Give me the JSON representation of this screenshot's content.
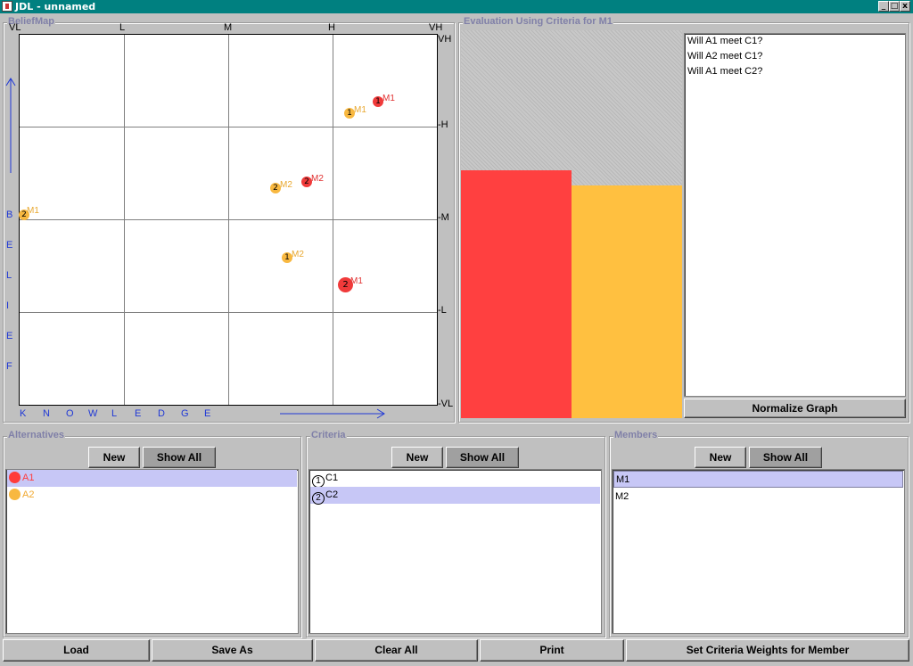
{
  "window": {
    "title": "JDL - unnamed",
    "min_glyph": "_",
    "max_glyph": "□",
    "close_glyph": "x"
  },
  "belief_map": {
    "title": "BeliefMap",
    "x_ticks": [
      "VL",
      "L",
      "M",
      "H",
      "VH"
    ],
    "y_ticks": [
      "VH",
      "-H",
      "-M",
      "-L",
      "-VL"
    ],
    "x_axis_letters": [
      "K",
      "N",
      "O",
      "W",
      "L",
      "E",
      "D",
      "G",
      "E"
    ],
    "y_axis_letters": [
      "B",
      "E",
      "L",
      "I",
      "E",
      "F"
    ],
    "points": [
      {
        "num": "1",
        "member": "M1",
        "alt": "A1",
        "color": "#f03a3a",
        "size": "small"
      },
      {
        "num": "1",
        "member": "M1",
        "alt": "A2",
        "color": "#f8b840",
        "size": "small"
      },
      {
        "num": "2",
        "member": "M2",
        "alt": "A2",
        "color": "#f8b840",
        "size": "small"
      },
      {
        "num": "2",
        "member": "M2",
        "alt": "A1",
        "color": "#f03a3a",
        "size": "small"
      },
      {
        "num": "2",
        "member": "M1",
        "alt": "A2",
        "color": "#f8b840",
        "size": "small"
      },
      {
        "num": "1",
        "member": "M2",
        "alt": "A2",
        "color": "#f8b840",
        "size": "small"
      },
      {
        "num": "2",
        "member": "M1",
        "alt": "A1",
        "color": "#f03a3a",
        "size": "big"
      }
    ]
  },
  "evaluation": {
    "title": "Evaluation Using Criteria for M1",
    "bars": [
      {
        "alt": "A1",
        "value": 0.64,
        "color": "#ff4040"
      },
      {
        "alt": "A2",
        "value": 0.6,
        "color": "#ffc040"
      }
    ],
    "questions": [
      "Will A1 meet C1?",
      "Will A2 meet C1?",
      "Will A1 meet C2?"
    ],
    "normalize_label": "Normalize Graph"
  },
  "alternatives": {
    "title": "Alternatives",
    "new_label": "New",
    "show_all_label": "Show All",
    "items": [
      {
        "label": "A1",
        "color": "#ff3b3b",
        "selected": true
      },
      {
        "label": "A2",
        "color": "#f8b840",
        "selected": false
      }
    ]
  },
  "criteria": {
    "title": "Criteria",
    "new_label": "New",
    "show_all_label": "Show All",
    "items": [
      {
        "num": "1",
        "label": "C1",
        "selected": false
      },
      {
        "num": "2",
        "label": "C2",
        "selected": true
      }
    ]
  },
  "members": {
    "title": "Members",
    "new_label": "New",
    "show_all_label": "Show All",
    "items": [
      {
        "label": "M1",
        "selected": true
      },
      {
        "label": "M2",
        "selected": false
      }
    ]
  },
  "footer": {
    "load_label": "Load",
    "save_as_label": "Save As",
    "clear_all_label": "Clear All",
    "print_label": "Print",
    "set_weights_label": "Set Criteria Weights for Member"
  }
}
